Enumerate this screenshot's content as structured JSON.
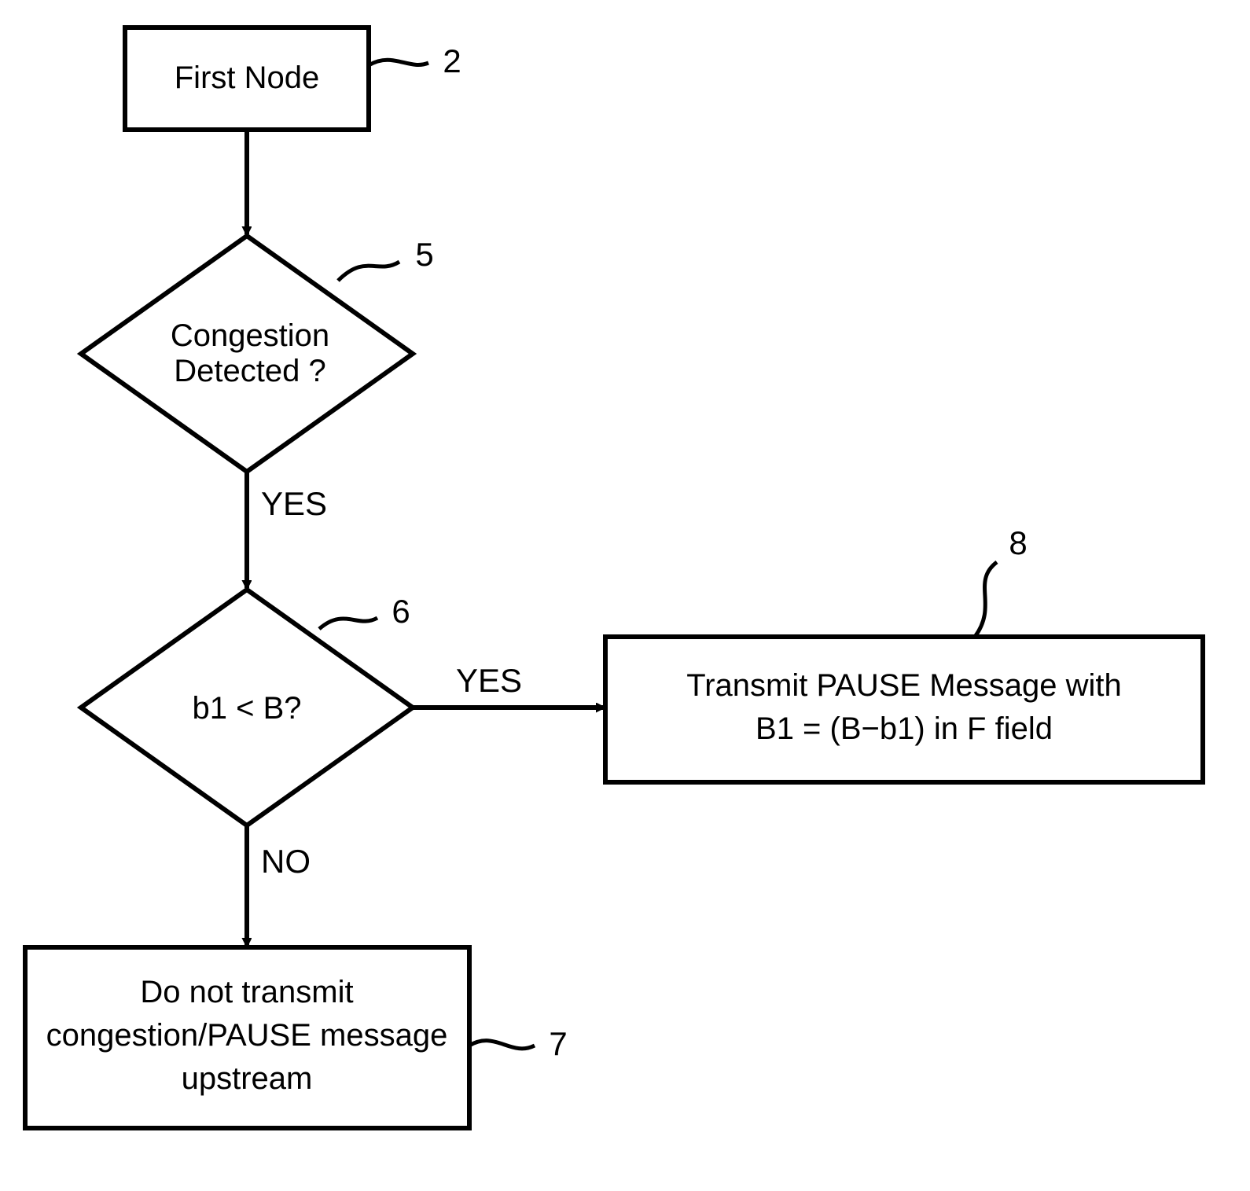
{
  "nodes": {
    "start": {
      "label": "First Node",
      "ref": "2"
    },
    "d1": {
      "line1": "Congestion",
      "line2": "Detected ?",
      "ref": "5"
    },
    "d2": {
      "line1": "b1  <  B?",
      "ref": "6"
    },
    "box_no": {
      "line1": "Do not transmit",
      "line2": "congestion/PAUSE message",
      "line3": "upstream",
      "ref": "7"
    },
    "box_yes": {
      "line1": "Transmit PAUSE Message with",
      "line2": "B1 = (B−b1) in F field",
      "ref": "8"
    }
  },
  "edges": {
    "d1_yes": "YES",
    "d2_yes": "YES",
    "d2_no": "NO"
  }
}
